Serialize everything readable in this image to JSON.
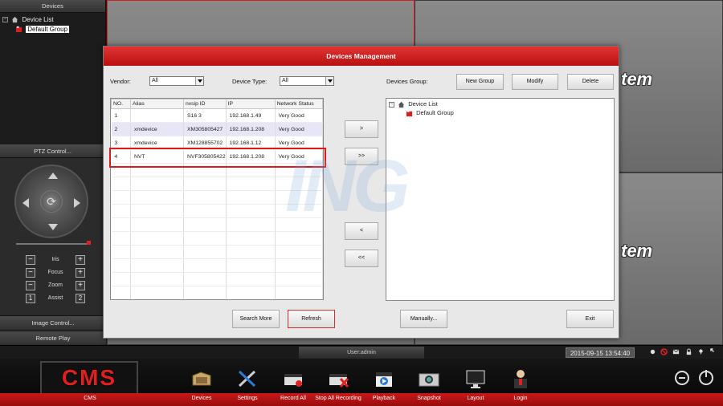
{
  "left_panel": {
    "devices_header": "Devices",
    "tree": {
      "root": "Device List",
      "child": "Default Group"
    },
    "ptz_header": "PTZ Control...",
    "controls": [
      {
        "label": "Iris",
        "minus": "−",
        "plus": "+"
      },
      {
        "label": "Focus",
        "minus": "−",
        "plus": "+"
      },
      {
        "label": "Zoom",
        "minus": "−",
        "plus": "+"
      },
      {
        "label": "Assist",
        "minus": "1",
        "plus": "2"
      }
    ],
    "dpad_center": "⟳",
    "image_control": "Image Control...",
    "remote_play": "Remote Play"
  },
  "background": {
    "brand_fragment": "tem"
  },
  "dialog": {
    "title": "Devices Management",
    "vendor_label": "Vendor:",
    "vendor_value": "All",
    "device_type_label": "Device Type:",
    "device_type_value": "All",
    "devices_group_label": "Devices Group:",
    "new_group": "New Group",
    "modify": "Modify",
    "delete": "Delete",
    "columns": [
      "NO.",
      "Alias",
      "nvsip ID",
      "IP",
      "Network Status"
    ],
    "rows": [
      [
        "1",
        "",
        "S16          3",
        "192.168.1.49",
        "Very Good"
      ],
      [
        "2",
        "xmdevice",
        "XM305805427",
        "192.168.1.208",
        "Very Good"
      ],
      [
        "3",
        "xmdevice",
        "XM128855702",
        "192.168.1.12",
        "Very Good"
      ],
      [
        "4",
        "NVT",
        "NVF305805422",
        "192.168.1.208",
        "Very Good"
      ]
    ],
    "move_one_right": ">",
    "move_all_right": ">>",
    "move_one_left": "<",
    "move_all_left": "<<",
    "group_tree": {
      "root": "Device List",
      "child": "Default Group"
    },
    "search_more": "Search More",
    "refresh": "Refresh",
    "manually": "Manually...",
    "exit": "Exit",
    "watermark": "ING"
  },
  "status": {
    "user": "User:admin",
    "datetime": "2015-09-15 13:54:40"
  },
  "toolbar": {
    "logo": "CMS",
    "cms_label": "CMS",
    "items": [
      "Devices",
      "Settings",
      "Record All",
      "Stop All Recording",
      "Playback",
      "Snapshot",
      "Layout",
      "Login"
    ]
  },
  "colors": {
    "accent_red": "#c81818",
    "highlight_red": "#e01818",
    "alt_row": "#e6e6f8"
  }
}
